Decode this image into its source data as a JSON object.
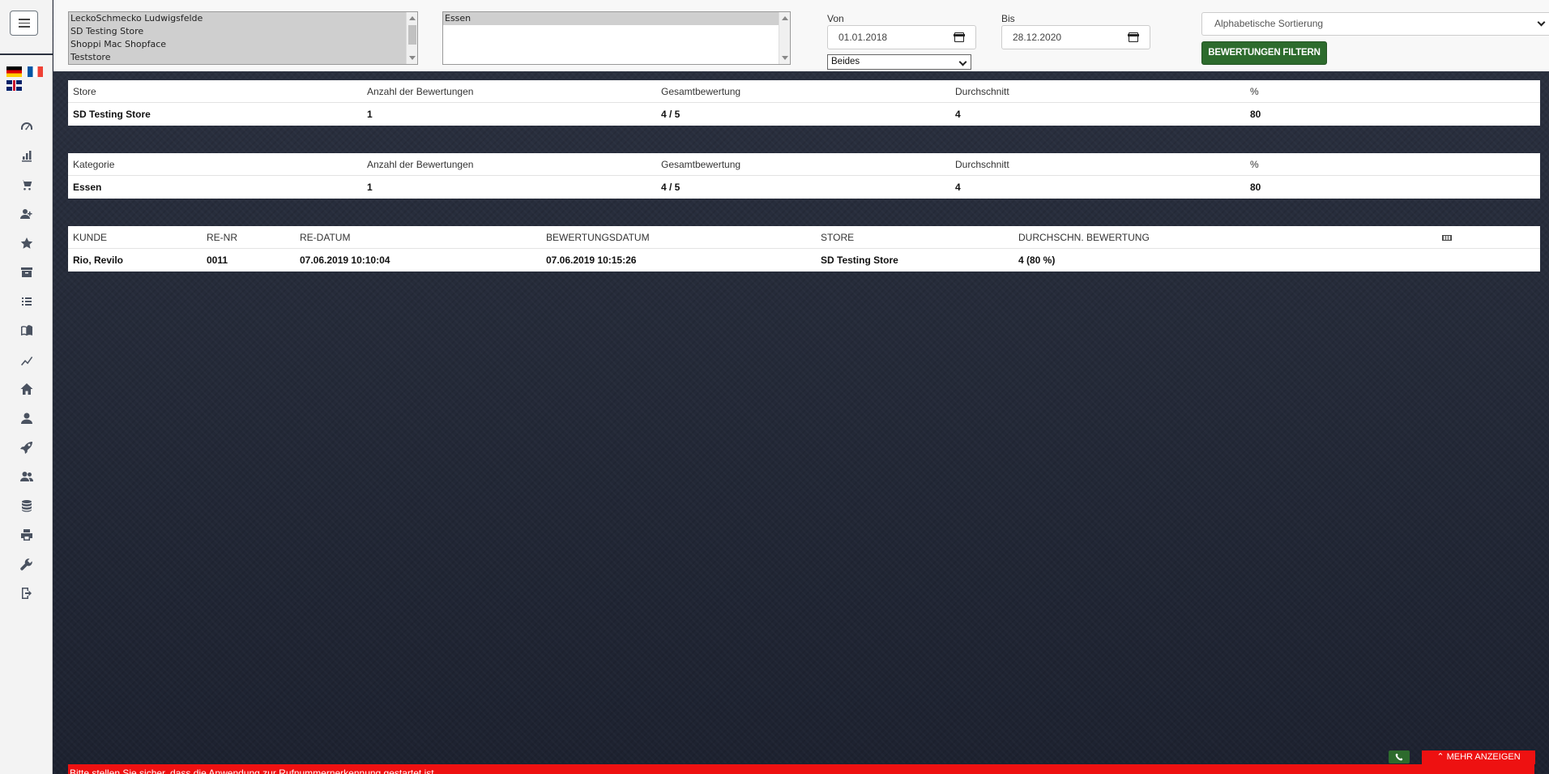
{
  "stores": {
    "options": [
      "LeckoSchmecko Ludwigsfelde",
      "SD Testing Store",
      "Shoppi Mac Shopface",
      "Teststore"
    ]
  },
  "categories": {
    "options": [
      "Essen"
    ]
  },
  "filters": {
    "from_label": "Von",
    "from_value": "01.01.2018",
    "to_label": "Bis",
    "to_value": "28.12.2020",
    "type_value": "Beides",
    "sort_value": "Alphabetische Sortierung",
    "filter_button": "BEWERTUNGEN FILTERN"
  },
  "sidebar": {
    "icons": [
      "dashboard-icon",
      "bar-chart-icon",
      "cart-icon",
      "add-user-icon",
      "star-icon",
      "archive-icon",
      "list-icon",
      "book-icon",
      "trend-icon",
      "home-icon",
      "user-icon",
      "rocket-icon",
      "users-icon",
      "database-icon",
      "print-icon",
      "wrench-icon",
      "logout-icon"
    ]
  },
  "store_table": {
    "headers": [
      "Store",
      "Anzahl der Bewertungen",
      "Gesamtbewertung",
      "Durchschnitt",
      "%"
    ],
    "rows": [
      [
        "SD Testing Store",
        "1",
        "4 / 5",
        "4",
        "80"
      ]
    ]
  },
  "category_table": {
    "headers": [
      "Kategorie",
      "Anzahl der Bewertungen",
      "Gesamtbewertung",
      "Durchschnitt",
      "%"
    ],
    "rows": [
      [
        "Essen",
        "1",
        "4 / 5",
        "4",
        "80"
      ]
    ]
  },
  "ratings_table": {
    "headers": [
      "KUNDE",
      "RE-NR",
      "RE-DATUM",
      "BEWERTUNGSDATUM",
      "STORE",
      "DURCHSCHN. BEWERTUNG"
    ],
    "rows": [
      [
        "Rio, Revilo",
        "0011",
        "07.06.2019 10:10:04",
        "07.06.2019 10:15:26",
        "SD Testing Store",
        "4 (80 %)"
      ]
    ]
  },
  "footer": {
    "notice": "Bitte stellen Sie sicher, dass die Anwendung zur Rufnummernerkennung gestartet ist",
    "more_button": "MEHR ANZEIGEN"
  }
}
